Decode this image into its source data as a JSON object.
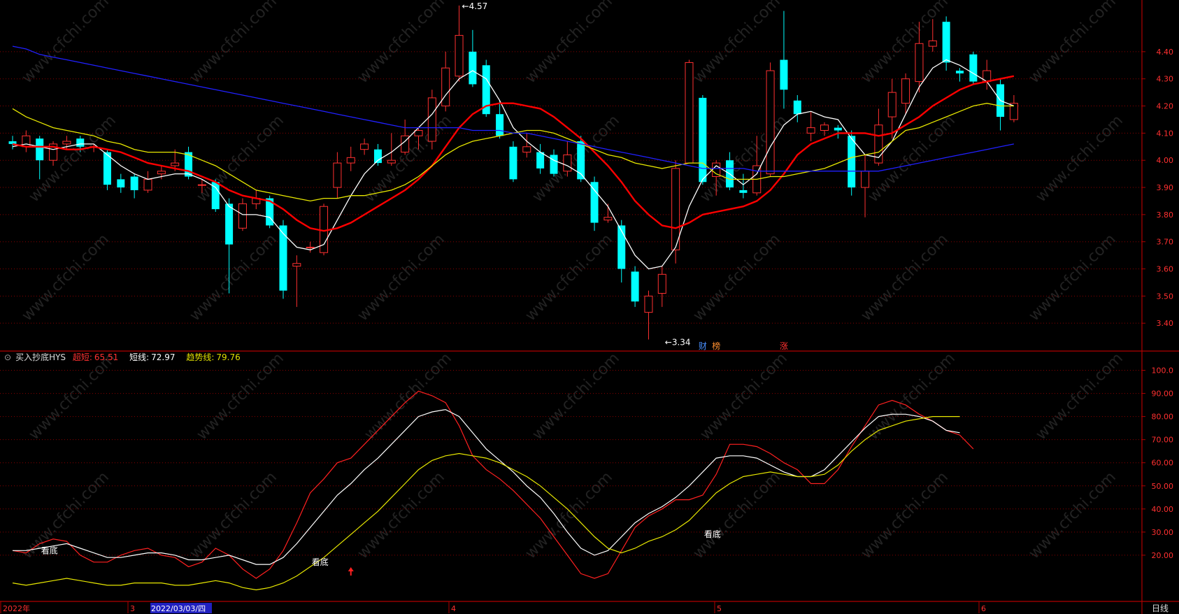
{
  "header": {
    "indicator_name": "买入抄底HYS",
    "fields": [
      {
        "label": "超短:",
        "value": "65.51",
        "color": "#ff3030"
      },
      {
        "label": "短线:",
        "value": "72.97",
        "color": "#ffffff"
      },
      {
        "label": "趋势线:",
        "value": "79.76",
        "color": "#e0e000"
      }
    ]
  },
  "watermark": "www.cfchi.com",
  "bottom_bar": {
    "period_label": "日线",
    "date_labels": [
      "2022年",
      "3",
      "2022/03/03/四",
      "4",
      "5",
      "6"
    ]
  },
  "colors": {
    "up": "#ff3030",
    "down": "#00ffff",
    "ma_fast": "#ffffff",
    "ma_mid": "#ff0000",
    "ma_slow": "#e8e800",
    "ma_long": "#2020ff",
    "grid": "#8a0000"
  },
  "chart_data": [
    {
      "type": "candlestick",
      "title": "",
      "ylim": [
        3.3,
        4.58
      ],
      "yticks": [
        3.4,
        3.5,
        3.6,
        3.7,
        3.8,
        3.9,
        4.0,
        4.1,
        4.2,
        4.3,
        4.4
      ],
      "ytick_labels": [
        "3.40",
        "3.50",
        "3.60",
        "3.70",
        "3.80",
        "3.90",
        "4.00",
        "4.10",
        "4.20",
        "4.30",
        "4.40"
      ],
      "annotations": [
        {
          "text": "4.57",
          "value": 4.57,
          "index": 33
        },
        {
          "text": "3.34",
          "value": 3.34,
          "index": 48
        }
      ],
      "event_markers": [
        {
          "text": "财",
          "index": 51,
          "color": "#4a90ff"
        },
        {
          "text": "榜",
          "index": 52,
          "color": "#ff9030"
        },
        {
          "text": "涨",
          "index": 57,
          "color": "#ff3030"
        }
      ],
      "candles": [
        [
          4.07,
          4.06,
          4.09,
          4.04
        ],
        [
          4.05,
          4.09,
          4.11,
          4.03
        ],
        [
          4.08,
          4.0,
          4.09,
          3.93
        ],
        [
          4.0,
          4.06,
          4.07,
          3.98
        ],
        [
          4.06,
          4.07,
          4.09,
          4.04
        ],
        [
          4.08,
          4.05,
          4.09,
          4.03
        ],
        [
          4.05,
          4.05,
          4.06,
          4.03
        ],
        [
          4.03,
          3.91,
          4.04,
          3.89
        ],
        [
          3.93,
          3.9,
          3.95,
          3.88
        ],
        [
          3.94,
          3.89,
          3.95,
          3.86
        ],
        [
          3.89,
          3.93,
          3.96,
          3.88
        ],
        [
          3.95,
          3.96,
          3.98,
          3.93
        ],
        [
          3.98,
          3.99,
          4.04,
          3.96
        ],
        [
          4.03,
          3.94,
          4.05,
          3.93
        ],
        [
          3.91,
          3.91,
          3.93,
          3.88
        ],
        [
          3.92,
          3.82,
          3.93,
          3.81
        ],
        [
          3.84,
          3.69,
          3.86,
          3.51
        ],
        [
          3.75,
          3.84,
          3.86,
          3.74
        ],
        [
          3.84,
          3.86,
          3.89,
          3.82
        ],
        [
          3.86,
          3.76,
          3.87,
          3.75
        ],
        [
          3.76,
          3.52,
          3.78,
          3.49
        ],
        [
          3.61,
          3.62,
          3.65,
          3.46
        ],
        [
          3.68,
          3.68,
          3.7,
          3.66
        ],
        [
          3.66,
          3.83,
          3.84,
          3.65
        ],
        [
          3.9,
          3.99,
          4.03,
          3.86
        ],
        [
          3.99,
          4.01,
          4.05,
          3.96
        ],
        [
          4.04,
          4.06,
          4.08,
          4.02
        ],
        [
          4.04,
          3.99,
          4.06,
          3.98
        ],
        [
          3.99,
          4.0,
          4.1,
          3.98
        ],
        [
          4.03,
          4.09,
          4.15,
          4.02
        ],
        [
          4.09,
          4.11,
          4.12,
          4.04
        ],
        [
          4.07,
          4.23,
          4.26,
          4.04
        ],
        [
          4.2,
          4.34,
          4.4,
          4.18
        ],
        [
          4.31,
          4.46,
          4.57,
          4.29
        ],
        [
          4.4,
          4.28,
          4.48,
          4.27
        ],
        [
          4.35,
          4.17,
          4.37,
          4.16
        ],
        [
          4.17,
          4.09,
          4.22,
          4.08
        ],
        [
          4.05,
          3.93,
          4.07,
          3.92
        ],
        [
          4.03,
          4.05,
          4.1,
          4.01
        ],
        [
          4.03,
          3.97,
          4.06,
          3.95
        ],
        [
          4.02,
          3.95,
          4.04,
          3.94
        ],
        [
          3.96,
          4.02,
          4.07,
          3.94
        ],
        [
          4.07,
          3.93,
          4.09,
          3.92
        ],
        [
          3.92,
          3.77,
          3.94,
          3.74
        ],
        [
          3.78,
          3.79,
          3.84,
          3.77
        ],
        [
          3.76,
          3.6,
          3.78,
          3.55
        ],
        [
          3.59,
          3.48,
          3.61,
          3.46
        ],
        [
          3.44,
          3.5,
          3.52,
          3.34
        ],
        [
          3.51,
          3.58,
          3.61,
          3.46
        ],
        [
          3.67,
          3.97,
          4.0,
          3.62
        ],
        [
          3.99,
          4.36,
          4.37,
          3.99
        ],
        [
          4.23,
          3.92,
          4.24,
          3.91
        ],
        [
          3.94,
          3.99,
          4.0,
          3.87
        ],
        [
          4.0,
          3.9,
          4.03,
          3.89
        ],
        [
          3.89,
          3.88,
          3.95,
          3.86
        ],
        [
          3.88,
          3.98,
          4.09,
          3.87
        ],
        [
          3.95,
          4.33,
          4.36,
          3.94
        ],
        [
          4.37,
          4.26,
          4.55,
          4.19
        ],
        [
          4.22,
          4.17,
          4.24,
          4.14
        ],
        [
          4.1,
          4.12,
          4.18,
          4.07
        ],
        [
          4.11,
          4.13,
          4.14,
          4.09
        ],
        [
          4.12,
          4.11,
          4.13,
          4.08
        ],
        [
          4.09,
          3.9,
          4.11,
          3.87
        ],
        [
          3.9,
          3.96,
          4.02,
          3.79
        ],
        [
          3.99,
          4.13,
          4.19,
          3.98
        ],
        [
          4.16,
          4.25,
          4.3,
          4.08
        ],
        [
          4.21,
          4.3,
          4.32,
          4.17
        ],
        [
          4.29,
          4.43,
          4.51,
          4.25
        ],
        [
          4.42,
          4.44,
          4.52,
          4.4
        ],
        [
          4.51,
          4.36,
          4.53,
          4.33
        ],
        [
          4.33,
          4.32,
          4.34,
          4.29
        ],
        [
          4.39,
          4.29,
          4.4,
          4.28
        ],
        [
          4.29,
          4.33,
          4.37,
          4.26
        ],
        [
          4.28,
          4.16,
          4.3,
          4.11
        ],
        [
          4.15,
          4.21,
          4.24,
          4.14
        ]
      ],
      "series": [
        {
          "name": "",
          "color": "#ffffff",
          "values": [
            4.05,
            4.06,
            4.05,
            4.04,
            4.05,
            4.06,
            4.06,
            4.02,
            3.98,
            3.95,
            3.93,
            3.94,
            3.95,
            3.95,
            3.93,
            3.9,
            3.83,
            3.8,
            3.8,
            3.79,
            3.73,
            3.68,
            3.67,
            3.69,
            3.78,
            3.87,
            3.95,
            4.0,
            4.03,
            4.07,
            4.12,
            4.17,
            4.24,
            4.3,
            4.33,
            4.3,
            4.22,
            4.12,
            4.07,
            4.03,
            4.0,
            3.98,
            3.95,
            3.89,
            3.83,
            3.74,
            3.65,
            3.6,
            3.61,
            3.68,
            3.83,
            3.93,
            3.98,
            3.95,
            3.91,
            3.95,
            4.05,
            4.13,
            4.17,
            4.18,
            4.16,
            4.15,
            4.08,
            4.02,
            4.01,
            4.07,
            4.17,
            4.27,
            4.34,
            4.37,
            4.35,
            4.32,
            4.29,
            4.22,
            4.2
          ]
        },
        {
          "name": "",
          "color": "#ff0000",
          "values": [
            4.06,
            4.05,
            4.05,
            4.05,
            4.04,
            4.04,
            4.05,
            4.04,
            4.03,
            4.01,
            3.99,
            3.98,
            3.97,
            3.96,
            3.94,
            3.92,
            3.89,
            3.87,
            3.86,
            3.85,
            3.82,
            3.78,
            3.75,
            3.74,
            3.75,
            3.77,
            3.8,
            3.83,
            3.86,
            3.89,
            3.93,
            3.98,
            4.05,
            4.12,
            4.17,
            4.2,
            4.21,
            4.21,
            4.2,
            4.19,
            4.16,
            4.12,
            4.08,
            4.03,
            3.98,
            3.92,
            3.85,
            3.8,
            3.76,
            3.75,
            3.77,
            3.8,
            3.81,
            3.82,
            3.83,
            3.85,
            3.89,
            3.95,
            4.02,
            4.06,
            4.08,
            4.1,
            4.1,
            4.1,
            4.09,
            4.1,
            4.13,
            4.16,
            4.2,
            4.23,
            4.26,
            4.28,
            4.29,
            4.3,
            4.31
          ]
        },
        {
          "name": "",
          "color": "#e8e800",
          "values": [
            4.19,
            4.16,
            4.14,
            4.12,
            4.11,
            4.1,
            4.09,
            4.07,
            4.06,
            4.04,
            4.03,
            4.03,
            4.03,
            4.02,
            4.0,
            3.98,
            3.95,
            3.92,
            3.89,
            3.88,
            3.87,
            3.86,
            3.85,
            3.86,
            3.86,
            3.87,
            3.87,
            3.88,
            3.89,
            3.91,
            3.94,
            3.98,
            4.02,
            4.05,
            4.07,
            4.08,
            4.09,
            4.1,
            4.11,
            4.11,
            4.1,
            4.08,
            4.06,
            4.04,
            4.02,
            4.01,
            3.99,
            3.98,
            3.97,
            3.98,
            3.99,
            3.99,
            3.95,
            3.93,
            3.93,
            3.93,
            3.94,
            3.94,
            3.95,
            3.96,
            3.97,
            3.99,
            4.01,
            4.02,
            4.03,
            4.07,
            4.11,
            4.12,
            4.14,
            4.16,
            4.18,
            4.2,
            4.21,
            4.2,
            4.2
          ]
        },
        {
          "name": "",
          "color": "#2020ff",
          "values": [
            4.42,
            4.41,
            4.39,
            4.38,
            4.37,
            4.36,
            4.35,
            4.34,
            4.33,
            4.32,
            4.31,
            4.3,
            4.29,
            4.28,
            4.27,
            4.26,
            4.25,
            4.24,
            4.23,
            4.22,
            4.21,
            4.2,
            4.19,
            4.18,
            4.17,
            4.16,
            4.15,
            4.14,
            4.13,
            4.12,
            4.12,
            4.12,
            4.12,
            4.12,
            4.11,
            4.11,
            4.11,
            4.1,
            4.1,
            4.09,
            4.08,
            4.07,
            4.06,
            4.05,
            4.04,
            4.03,
            4.02,
            4.01,
            4.0,
            3.99,
            3.98,
            3.97,
            3.97,
            3.97,
            3.97,
            3.96,
            3.96,
            3.96,
            3.96,
            3.96,
            3.96,
            3.96,
            3.96,
            3.96,
            3.96,
            3.97,
            3.98,
            3.99,
            4.0,
            4.01,
            4.02,
            4.03,
            4.04,
            4.05,
            4.06
          ]
        }
      ]
    },
    {
      "type": "line",
      "title": "买入抄底HYS",
      "ylim": [
        0,
        105
      ],
      "yticks": [
        20,
        30,
        40,
        50,
        60,
        70,
        80,
        90,
        100
      ],
      "ytick_labels": [
        "20.00",
        "30.00",
        "40.00",
        "50.00",
        "60.00",
        "70.00",
        "80.00",
        "90.00",
        "100.0"
      ],
      "annotations": [
        {
          "text": "看底",
          "index": 2,
          "value": 22
        },
        {
          "text": "看底",
          "index": 22,
          "value": 17
        },
        {
          "text": "看底",
          "index": 51,
          "value": 29
        }
      ],
      "arrow_markers": [
        {
          "index": 25,
          "value": 13,
          "color": "#ff2020"
        }
      ],
      "series": [
        {
          "name": "超短",
          "color": "#ff2020",
          "values": [
            22,
            21,
            25,
            27,
            26,
            20,
            17,
            17,
            20,
            22,
            23,
            20,
            19,
            15,
            17,
            23,
            20,
            14,
            10,
            14,
            22,
            34,
            47,
            53,
            60,
            62,
            68,
            74,
            80,
            86,
            91,
            89,
            86,
            76,
            63,
            57,
            53,
            48,
            42,
            36,
            28,
            20,
            12,
            10,
            12,
            22,
            32,
            37,
            40,
            44,
            44,
            46,
            55,
            68,
            68,
            67,
            64,
            60,
            57,
            51,
            51,
            57,
            67,
            76,
            85,
            87,
            85,
            81,
            78,
            74,
            72,
            66
          ]
        },
        {
          "name": "短线",
          "color": "#ffffff",
          "values": [
            22,
            22,
            23,
            24,
            25,
            23,
            21,
            19,
            19,
            20,
            21,
            21,
            20,
            18,
            18,
            19,
            20,
            18,
            16,
            16,
            19,
            25,
            32,
            39,
            46,
            51,
            57,
            62,
            68,
            74,
            80,
            82,
            83,
            80,
            73,
            66,
            61,
            56,
            50,
            45,
            38,
            30,
            23,
            20,
            22,
            28,
            34,
            38,
            41,
            45,
            50,
            56,
            62,
            63,
            63,
            62,
            59,
            56,
            54,
            54,
            57,
            63,
            69,
            75,
            80,
            81,
            81,
            80,
            78,
            74,
            73
          ]
        },
        {
          "name": "趋势线",
          "color": "#e8e800",
          "values": [
            8,
            7,
            8,
            9,
            10,
            9,
            8,
            7,
            7,
            8,
            8,
            8,
            7,
            7,
            8,
            9,
            8,
            6,
            5,
            6,
            8,
            11,
            15,
            19,
            24,
            29,
            34,
            39,
            45,
            51,
            57,
            61,
            63,
            64,
            63,
            62,
            60,
            57,
            54,
            50,
            45,
            40,
            34,
            28,
            23,
            21,
            23,
            26,
            28,
            31,
            35,
            41,
            47,
            51,
            54,
            55,
            56,
            55,
            54,
            54,
            55,
            59,
            65,
            70,
            74,
            76,
            78,
            79,
            80,
            80,
            80
          ]
        }
      ]
    }
  ]
}
